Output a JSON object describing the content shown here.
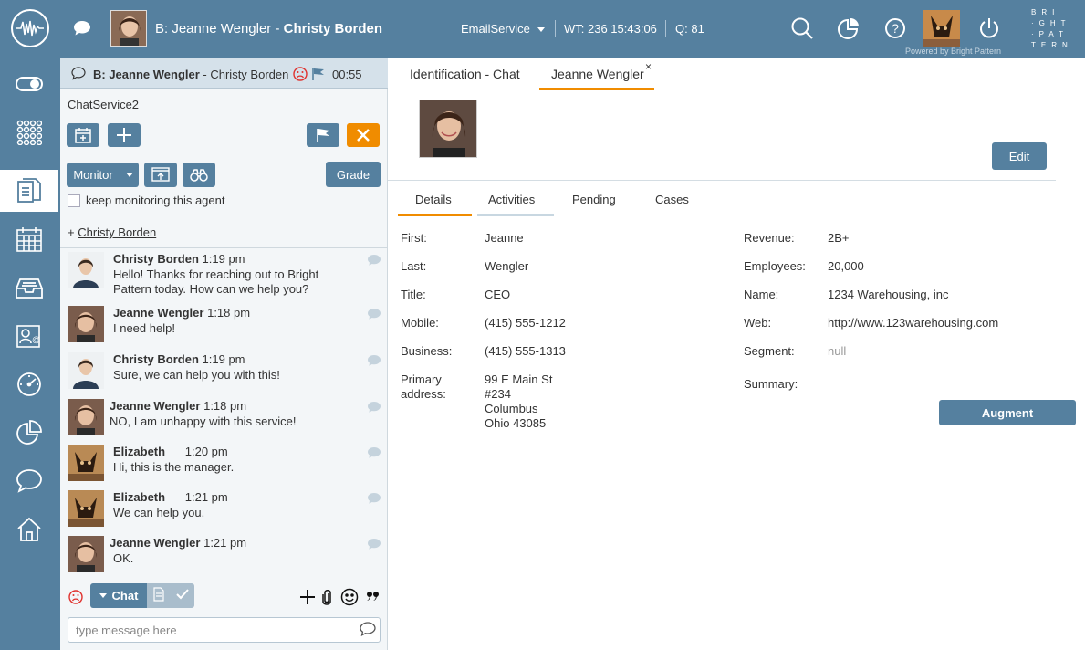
{
  "topbar": {
    "agent_prefix": "B: Jeanne Wengler",
    "agent_sep": " - ",
    "agent_name": "Christy Borden",
    "service": "EmailService",
    "wt": "WT: 236 15:43:06",
    "q": "Q: 81",
    "powered": "Powered by Bright Pattern",
    "brand": "BRI·GHT·PAT·TERN"
  },
  "chat": {
    "header_prefix": "B: Jeanne Wengler",
    "header_sep": " - ",
    "header_name": "Christy Borden",
    "header_time": "00:55",
    "service_name": "ChatService2",
    "monitor_label": "Monitor",
    "grade_label": "Grade",
    "keep_monitoring": "keep monitoring this agent",
    "add_prefix": "+ ",
    "add_link": "Christy Borden",
    "chat_button": "Chat",
    "input_placeholder": "type message here",
    "messages": [
      {
        "name": "Christy Borden",
        "time": "1:19 pm",
        "text": "Hello! Thanks for reaching out to Bright Pattern today. How can we help you?"
      },
      {
        "name": "Jeanne Wengler",
        "time": "1:18 pm",
        "text": "I need help!"
      },
      {
        "name": "Christy Borden",
        "time": "1:19 pm",
        "text": "Sure, we can help you with this!"
      },
      {
        "name": "Jeanne Wengler",
        "time": "1:18 pm",
        "text": "NO, I am unhappy with this service!"
      },
      {
        "name": "Elizabeth",
        "time": "1:20 pm",
        "text": "Hi, this is the manager."
      },
      {
        "name": "Elizabeth",
        "time": "1:21 pm",
        "text": "We can help you."
      },
      {
        "name": "Jeanne Wengler",
        "time": "1:21 pm",
        "text": "OK."
      }
    ]
  },
  "content": {
    "tabs": [
      "Identification - Chat",
      "Jeanne Wengler"
    ],
    "tab_close": "×",
    "edit_label": "Edit",
    "detail_tabs": [
      "Details",
      "Activities",
      "Pending",
      "Cases"
    ],
    "left_fields": [
      {
        "label": "First:",
        "value": "Jeanne"
      },
      {
        "label": "Last:",
        "value": "Wengler"
      },
      {
        "label": "Title:",
        "value": "CEO"
      },
      {
        "label": "Mobile:",
        "value": "(415) 555-1212"
      },
      {
        "label": "Business:",
        "value": "(415) 555-1313"
      },
      {
        "label": "Primary address:",
        "value": "99 E Main St #234 Columbus Ohio 43085"
      }
    ],
    "address_lines": [
      "99 E Main St",
      "#234",
      "Columbus",
      "Ohio 43085"
    ],
    "right_fields": [
      {
        "label": "Revenue:",
        "value": "2B+"
      },
      {
        "label": "Employees:",
        "value": "20,000"
      },
      {
        "label": "Name:",
        "value": "1234 Warehousing, inc"
      },
      {
        "label": "Web:",
        "value": "http://www.123warehousing.com"
      },
      {
        "label": "Segment:",
        "value": "null"
      },
      {
        "label": "Summary:",
        "value": ""
      }
    ],
    "augment_label": "Augment"
  },
  "colors": {
    "primary": "#55809f",
    "accent": "#f08c00",
    "sad": "#e0312d"
  }
}
